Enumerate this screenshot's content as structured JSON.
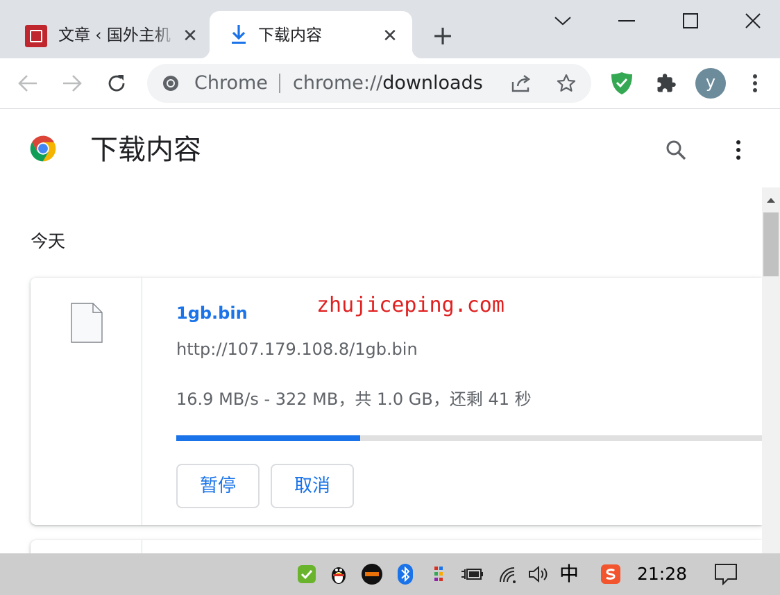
{
  "tabs": [
    {
      "title": "文章 ‹ 国外主机",
      "icon": "site-favicon",
      "active": false
    },
    {
      "title": "下载内容",
      "icon": "download-icon",
      "active": true
    }
  ],
  "omnibox": {
    "chip": "Chrome",
    "url_scheme": "chrome://",
    "url_host": "downloads"
  },
  "profile": {
    "initial": "y"
  },
  "page": {
    "title": "下载内容",
    "date_header": "今天"
  },
  "download": {
    "file_name": "1gb.bin",
    "url": "http://107.179.108.8/1gb.bin",
    "status": "16.9 MB/s - 322 MB，共 1.0 GB，还剩 41 秒",
    "progress_percent": 31.4,
    "pause_label": "暂停",
    "cancel_label": "取消"
  },
  "watermark": "zhujiceping.com",
  "taskbar": {
    "lang": "中",
    "time": "21:28"
  },
  "colors": {
    "accent": "#1a73e8",
    "tabstrip": "#dee1e6",
    "watermark": "#e02020",
    "taskbar": "#cdcdcd"
  }
}
